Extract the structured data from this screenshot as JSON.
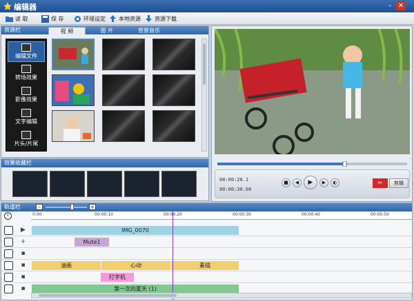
{
  "app": {
    "title": "编辑器"
  },
  "toolbar": {
    "read": "读 取",
    "save": "保 存",
    "env": "环境设定",
    "local": "本地资源",
    "download": "资源下载"
  },
  "resources": {
    "panel_title": "资源栏",
    "tabs": [
      "视 频",
      "图 片",
      "背景音乐"
    ],
    "side_menu": [
      "编辑文件",
      "转场效果",
      "影像效果",
      "文字编辑",
      "片头/片尾"
    ]
  },
  "effects": {
    "panel_title": "效果收藏栏"
  },
  "preview": {
    "current_time": "00:00:20.1",
    "total_time": "00:00:30.00",
    "cut_button": "剪辑"
  },
  "tracks": {
    "panel_title": "轨道栏",
    "ruler": [
      "0:00",
      "00:00:10",
      "00:00:20",
      "00:00:30",
      "00:00:40",
      "00:00:50"
    ],
    "video_clip": "IMG_0070",
    "audio_clip": "Mute1",
    "effect_clips": [
      "油画",
      "心动",
      "素描"
    ],
    "text_clip": "打字机",
    "music_clip": "第一次的夏天 (1)"
  },
  "colors": {
    "title_bar": "#1d4f93",
    "video_track": "#9fd3e3",
    "audio_track": "#c7a6d6",
    "effect_track": "#f2cf6e",
    "text_track": "#f59ad7",
    "music_track": "#7fca8c",
    "playhead": "#7a3ad0"
  }
}
